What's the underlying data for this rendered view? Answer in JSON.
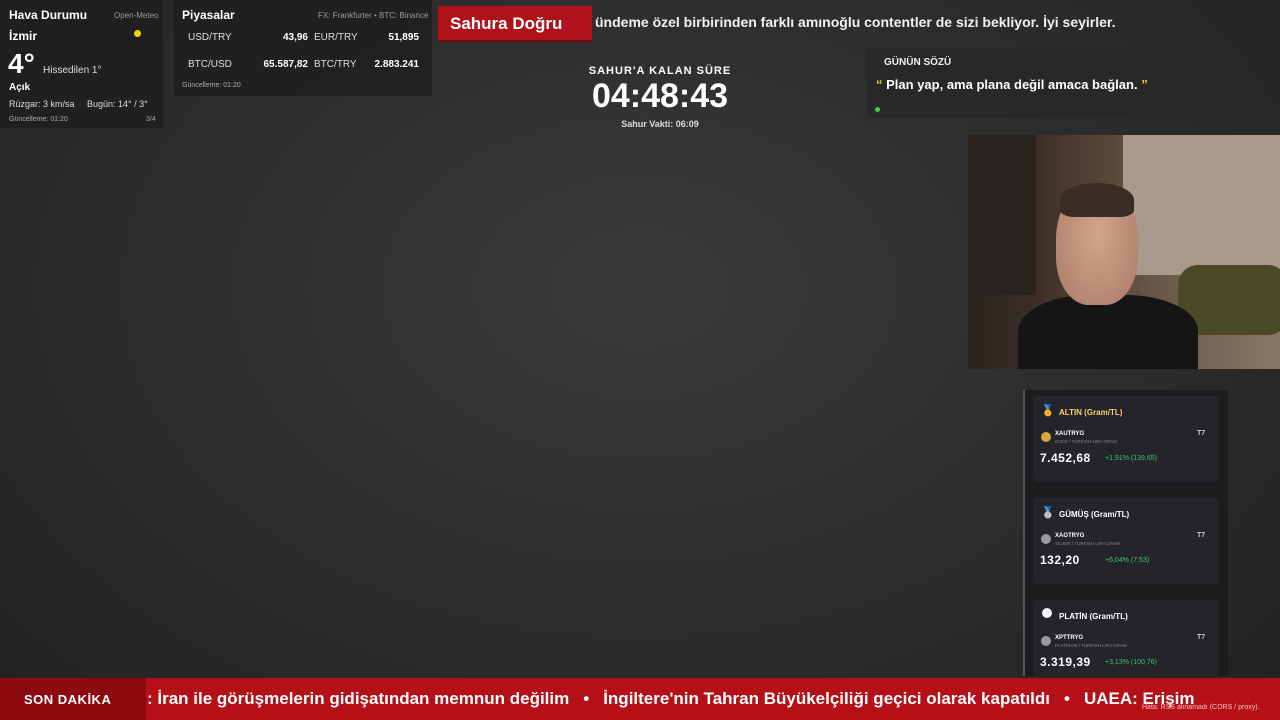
{
  "weather": {
    "title": "Hava Durumu",
    "source": "Open-Meteo",
    "city": "İzmir",
    "temperature": "4°",
    "feels_like": "Hissedilen 1°",
    "condition": "Açık",
    "wind": "Rüzgar: 3 km/sa",
    "today": "Bugün: 14° / 3°",
    "updated": "Güncelleme: 01:20",
    "page": "3/4",
    "icon": "sun-icon"
  },
  "markets": {
    "title": "Piyasalar",
    "source": "FX: Frankfurter • BTC: Binance",
    "updated": "Güncelleme: 01:20",
    "rates": [
      {
        "label": "USD/TRY",
        "value": "43,96"
      },
      {
        "label": "EUR/TRY",
        "value": "51,895"
      },
      {
        "label": "BTC/USD",
        "value": "65.587,82"
      },
      {
        "label": "BTC/TRY",
        "value": "2.883.241"
      }
    ]
  },
  "banner": {
    "tag": "Sahura Doğru",
    "text": "ündeme özel birbirinden farklı amınoğlu contentler de sizi bekliyor. İyi seyirler."
  },
  "countdown": {
    "label": "SAHUR'A KALAN SÜRE",
    "time": "04:48:43",
    "sahur_time": "Sahur Vakti: 06:09"
  },
  "quote": {
    "title": "GÜNÜN SÖZÜ",
    "open_mark": "“",
    "text": "Plan yap, ama plana değil amaca bağlan.",
    "close_mark": "”"
  },
  "metals": [
    {
      "title": "ALTIN (Gram/TL)",
      "symbol": "XAUTRYG",
      "desc": "GOLD / TURKISH LIRA GRAM",
      "price": "7.452,68",
      "change": "+1,91% (139,65)",
      "title_color": "#f5d26a",
      "icon": "gold-medal-icon",
      "coin_color": "#d4a83a"
    },
    {
      "title": "GÜMÜŞ (Gram/TL)",
      "symbol": "XAGTRYG",
      "desc": "SILVER / TURKISH LIRA GRAM",
      "price": "132,20",
      "change": "+6,04% (7,53)",
      "title_color": "#ffffff",
      "icon": "silver-medal-icon",
      "coin_color": "#9a9a9a"
    },
    {
      "title": "PLATİN (Gram/TL)",
      "symbol": "XPTTRYG",
      "desc": "PLATINUM / TURKISH LIRA GRAM",
      "price": "3.319,39",
      "change": "+3,13% (100,76)",
      "title_color": "#ffffff",
      "icon": "platinum-circle-icon",
      "coin_color": "#9a9a9a"
    }
  ],
  "ticker": {
    "tag": "SON DAKİKA",
    "items": [
      ": İran ile görüşmelerin gidişatından memnun değilim",
      "İngiltere'nin Tahran Büyükelçiliği geçici olarak kapatıldı",
      "UAEA: Erişim"
    ],
    "separator": "•",
    "error": "Hata: RSS alınamadı (CORS / proxy)."
  }
}
